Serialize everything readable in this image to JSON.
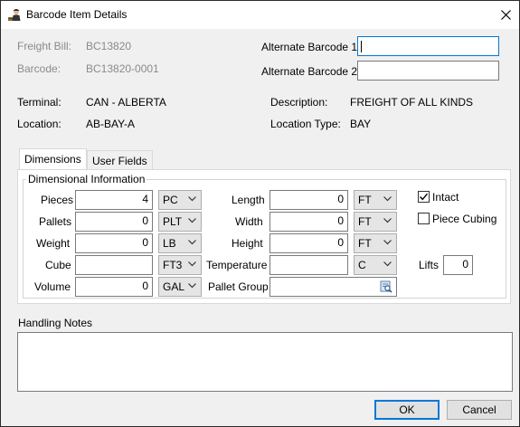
{
  "window": {
    "title": "Barcode Item Details"
  },
  "header": {
    "freight_bill_label": "Freight Bill:",
    "freight_bill_value": "BC13820",
    "barcode_label": "Barcode:",
    "barcode_value": "BC13820-0001",
    "alt_barcode1_label": "Alternate Barcode 1",
    "alt_barcode1_value": "",
    "alt_barcode2_label": "Alternate Barcode 2",
    "alt_barcode2_value": "",
    "terminal_label": "Terminal:",
    "terminal_value": "CAN - ALBERTA",
    "location_label": "Location:",
    "location_value": "AB-BAY-A",
    "description_label": "Description:",
    "description_value": "FREIGHT OF ALL KINDS",
    "location_type_label": "Location Type:",
    "location_type_value": "BAY"
  },
  "tabs": [
    {
      "label": "Dimensions",
      "active": true
    },
    {
      "label": "User Fields",
      "active": false
    }
  ],
  "dimensions": {
    "group_title": "Dimensional Information",
    "pieces": {
      "label": "Pieces",
      "value": "4",
      "unit": "PC"
    },
    "pallets": {
      "label": "Pallets",
      "value": "0",
      "unit": "PLT"
    },
    "weight": {
      "label": "Weight",
      "value": "0",
      "unit": "LB"
    },
    "cube": {
      "label": "Cube",
      "value": "",
      "unit": "FT3"
    },
    "volume": {
      "label": "Volume",
      "value": "0",
      "unit": "GAL"
    },
    "length": {
      "label": "Length",
      "value": "0",
      "unit": "FT"
    },
    "width": {
      "label": "Width",
      "value": "0",
      "unit": "FT"
    },
    "height": {
      "label": "Height",
      "value": "0",
      "unit": "FT"
    },
    "temperature": {
      "label": "Temperature",
      "value": "",
      "unit": "C"
    },
    "pallet_group": {
      "label": "Pallet Group",
      "value": ""
    },
    "intact": {
      "label": "Intact",
      "checked": true
    },
    "piece_cubing": {
      "label": "Piece Cubing",
      "checked": false
    },
    "lifts": {
      "label": "Lifts",
      "value": "0"
    }
  },
  "handling_notes": {
    "label": "Handling Notes",
    "value": ""
  },
  "footer": {
    "ok_label": "OK",
    "cancel_label": "Cancel"
  },
  "colors": {
    "focus_border": "#0078d7",
    "disabled_label": "#8a8a8a",
    "window_bg": "#f0f0f0"
  }
}
